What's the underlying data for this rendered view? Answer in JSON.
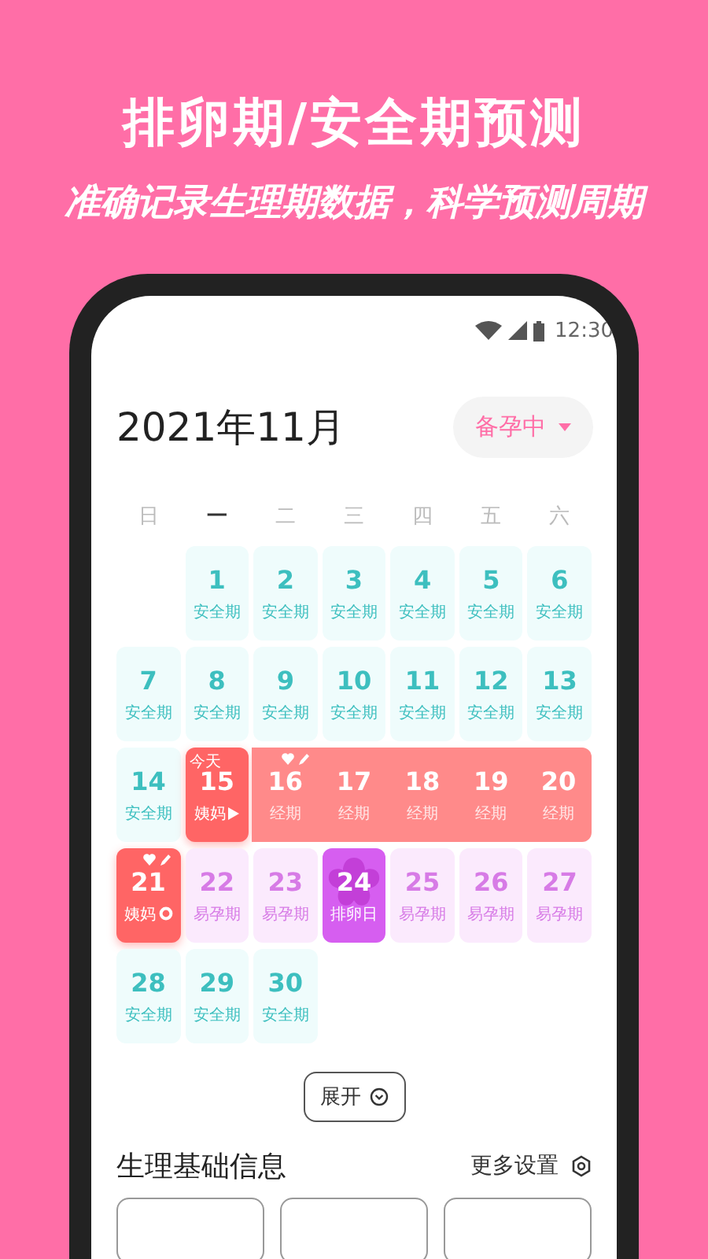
{
  "promo": {
    "title": "排卵期/安全期预测",
    "subtitle": "准确记录生理期数据，科学预测周期"
  },
  "status_bar": {
    "time": "12:30"
  },
  "header": {
    "month": "2021年11月",
    "mode": "备孕中"
  },
  "weekdays": [
    {
      "label": "日",
      "selected": false
    },
    {
      "label": "一",
      "selected": true
    },
    {
      "label": "二",
      "selected": false
    },
    {
      "label": "三",
      "selected": false
    },
    {
      "label": "四",
      "selected": false
    },
    {
      "label": "五",
      "selected": false
    },
    {
      "label": "六",
      "selected": false
    }
  ],
  "days": [
    {
      "kind": "empty"
    },
    {
      "day": "1",
      "label": "安全期",
      "kind": "safe"
    },
    {
      "day": "2",
      "label": "安全期",
      "kind": "safe"
    },
    {
      "day": "3",
      "label": "安全期",
      "kind": "safe"
    },
    {
      "day": "4",
      "label": "安全期",
      "kind": "safe"
    },
    {
      "day": "5",
      "label": "安全期",
      "kind": "safe"
    },
    {
      "day": "6",
      "label": "安全期",
      "kind": "safe"
    },
    {
      "day": "7",
      "label": "安全期",
      "kind": "safe"
    },
    {
      "day": "8",
      "label": "安全期",
      "kind": "safe"
    },
    {
      "day": "9",
      "label": "安全期",
      "kind": "safe"
    },
    {
      "day": "10",
      "label": "安全期",
      "kind": "safe"
    },
    {
      "day": "11",
      "label": "安全期",
      "kind": "safe"
    },
    {
      "day": "12",
      "label": "安全期",
      "kind": "safe"
    },
    {
      "day": "13",
      "label": "安全期",
      "kind": "safe"
    },
    {
      "day": "14",
      "label": "安全期",
      "kind": "safe"
    },
    {
      "day": "15",
      "label": "姨妈",
      "kind": "period-start",
      "today_label": "今天",
      "play_icon": true,
      "records": false
    },
    {
      "day": "16",
      "label": "经期",
      "kind": "period",
      "records": true
    },
    {
      "day": "17",
      "label": "经期",
      "kind": "period",
      "records": false
    },
    {
      "day": "18",
      "label": "经期",
      "kind": "period",
      "records": false
    },
    {
      "day": "19",
      "label": "经期",
      "kind": "period",
      "records": false
    },
    {
      "day": "20",
      "label": "经期",
      "kind": "period-end",
      "records": false
    },
    {
      "day": "21",
      "label": "姨妈",
      "kind": "period-start",
      "ring_icon": true,
      "records": true
    },
    {
      "day": "22",
      "label": "易孕期",
      "kind": "fertile"
    },
    {
      "day": "23",
      "label": "易孕期",
      "kind": "fertile"
    },
    {
      "day": "24",
      "label": "排卵日",
      "kind": "ovulation"
    },
    {
      "day": "25",
      "label": "易孕期",
      "kind": "fertile"
    },
    {
      "day": "26",
      "label": "易孕期",
      "kind": "fertile"
    },
    {
      "day": "27",
      "label": "易孕期",
      "kind": "fertile"
    },
    {
      "day": "28",
      "label": "安全期",
      "kind": "safe"
    },
    {
      "day": "29",
      "label": "安全期",
      "kind": "safe"
    },
    {
      "day": "30",
      "label": "安全期",
      "kind": "safe"
    }
  ],
  "expand_button": "展开",
  "section": {
    "title": "生理基础信息",
    "more": "更多设置"
  }
}
